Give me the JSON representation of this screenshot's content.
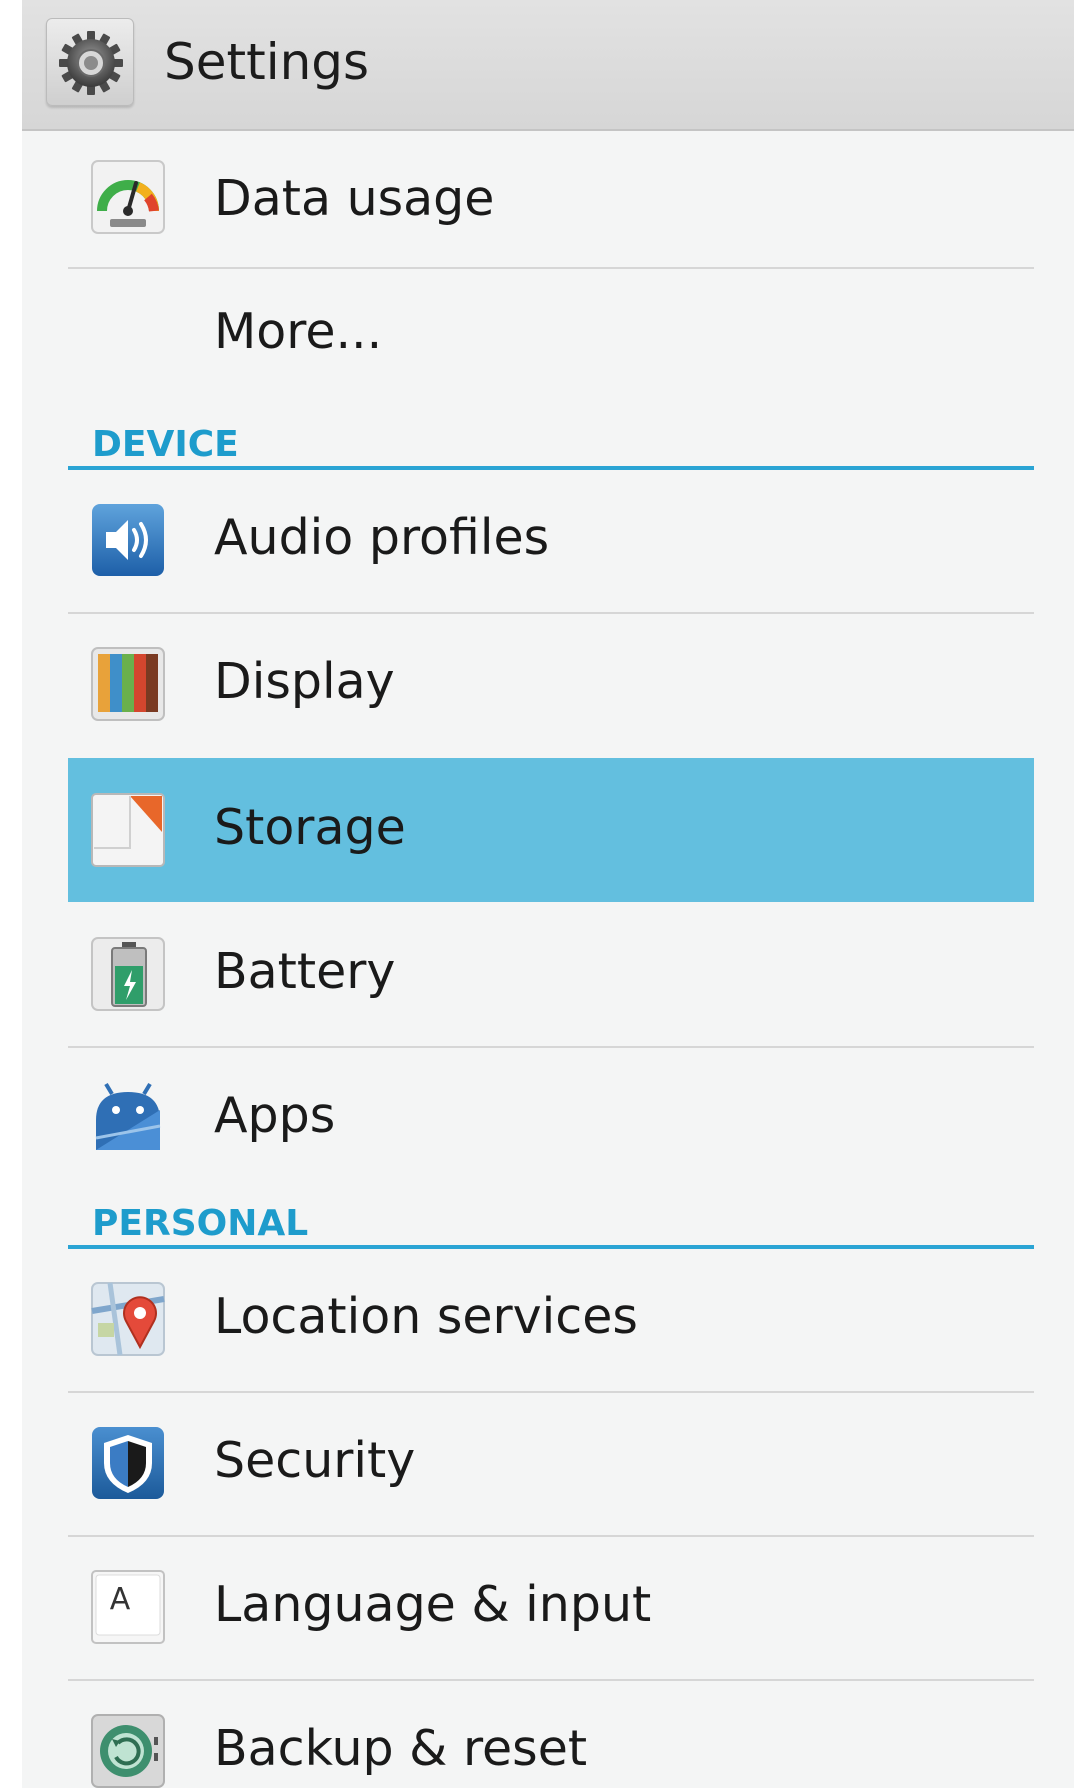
{
  "action_bar": {
    "icon": "settings-gear-icon",
    "title": "Settings"
  },
  "list": {
    "selection_color": "#63bfdf",
    "section_color": "#1e9ccc",
    "items_top": [
      {
        "label": "Data usage",
        "icon": "data-usage-gauge-icon"
      },
      {
        "label": "More...",
        "icon": ""
      }
    ],
    "sections": [
      {
        "header": "DEVICE",
        "items": [
          {
            "label": "Audio profiles",
            "icon": "speaker-icon"
          },
          {
            "label": "Display",
            "icon": "display-color-bars-icon"
          },
          {
            "label": "Storage",
            "icon": "storage-icon",
            "selected": true
          },
          {
            "label": "Battery",
            "icon": "battery-icon"
          },
          {
            "label": "Apps",
            "icon": "android-apps-icon"
          }
        ]
      },
      {
        "header": "PERSONAL",
        "items": [
          {
            "label": "Location services",
            "icon": "map-pin-icon"
          },
          {
            "label": "Security",
            "icon": "shield-icon"
          },
          {
            "label": "Language & input",
            "icon": "keyboard-a-key-icon"
          },
          {
            "label": "Backup & reset",
            "icon": "backup-restore-icon"
          }
        ]
      }
    ]
  }
}
